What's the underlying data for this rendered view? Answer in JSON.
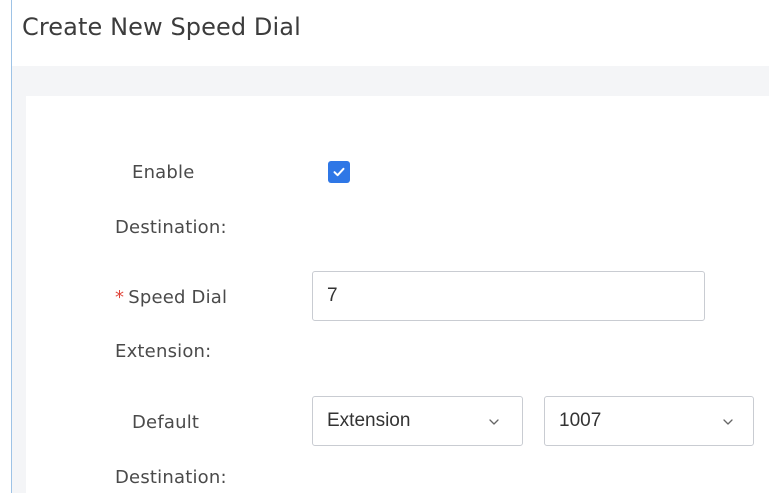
{
  "dialog": {
    "title": "Create New Speed Dial"
  },
  "form": {
    "enable_destination": {
      "label_line1": "Enable",
      "label_line2": "Destination:",
      "checked": true
    },
    "speed_dial_extension": {
      "required_mark": "*",
      "label_line1": "Speed Dial",
      "label_line2": "Extension:",
      "value": "7"
    },
    "default_destination": {
      "label_line1": "Default",
      "label_line2": "Destination:",
      "type_value": "Extension",
      "target_value": "1007"
    }
  },
  "icons": {
    "checkbox": "check-icon",
    "dropdown": "chevron-down-icon"
  },
  "colors": {
    "accent": "#2f77e6",
    "required": "#e0463b",
    "border": "#c9ccd2"
  }
}
